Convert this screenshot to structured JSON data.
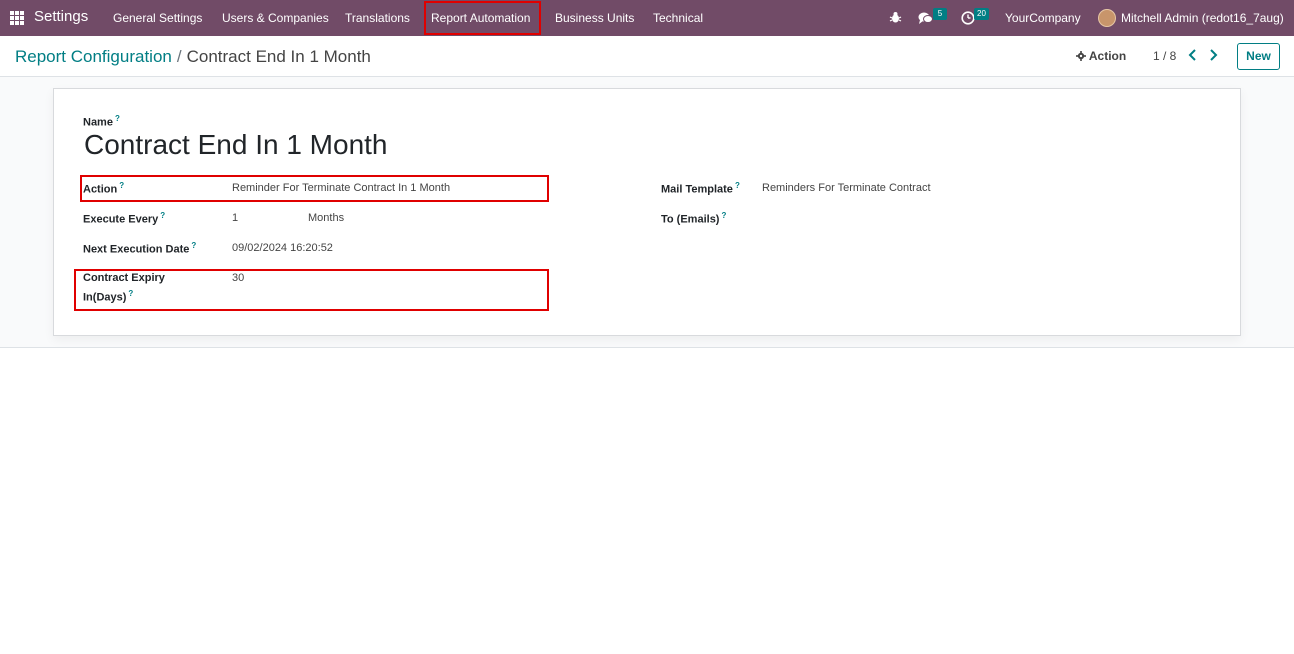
{
  "navbar": {
    "brand": "Settings",
    "menu": [
      "General Settings",
      "Users & Companies",
      "Translations",
      "Report Automation",
      "Business Units",
      "Technical"
    ],
    "messages_count": "5",
    "activities_count": "20",
    "company": "YourCompany",
    "user": "Mitchell Admin (redot16_7aug)"
  },
  "breadcrumb": {
    "parent": "Report Configuration",
    "separator": "/",
    "current": "Contract End In 1 Month"
  },
  "control": {
    "action_label": "Action",
    "pager": "1 / 8",
    "new_label": "New"
  },
  "form": {
    "name_label": "Name",
    "help_mark": "?",
    "name_value": "Contract End In 1 Month",
    "action_label": "Action",
    "action_value": "Reminder For Terminate Contract In 1 Month",
    "execute_label": "Execute Every",
    "execute_value": "1",
    "execute_unit": "Months",
    "next_exec_label": "Next Execution Date",
    "next_exec_value": "09/02/2024 16:20:52",
    "expiry_label_line1": "Contract Expiry",
    "expiry_label_line2": "In(Days)",
    "expiry_value": "30",
    "mail_template_label": "Mail Template",
    "mail_template_value": "Reminders For Terminate Contract",
    "to_emails_label": "To (Emails)"
  },
  "colors": {
    "navbar": "#714b67",
    "accent": "#017e84",
    "highlight": "#e00000"
  }
}
